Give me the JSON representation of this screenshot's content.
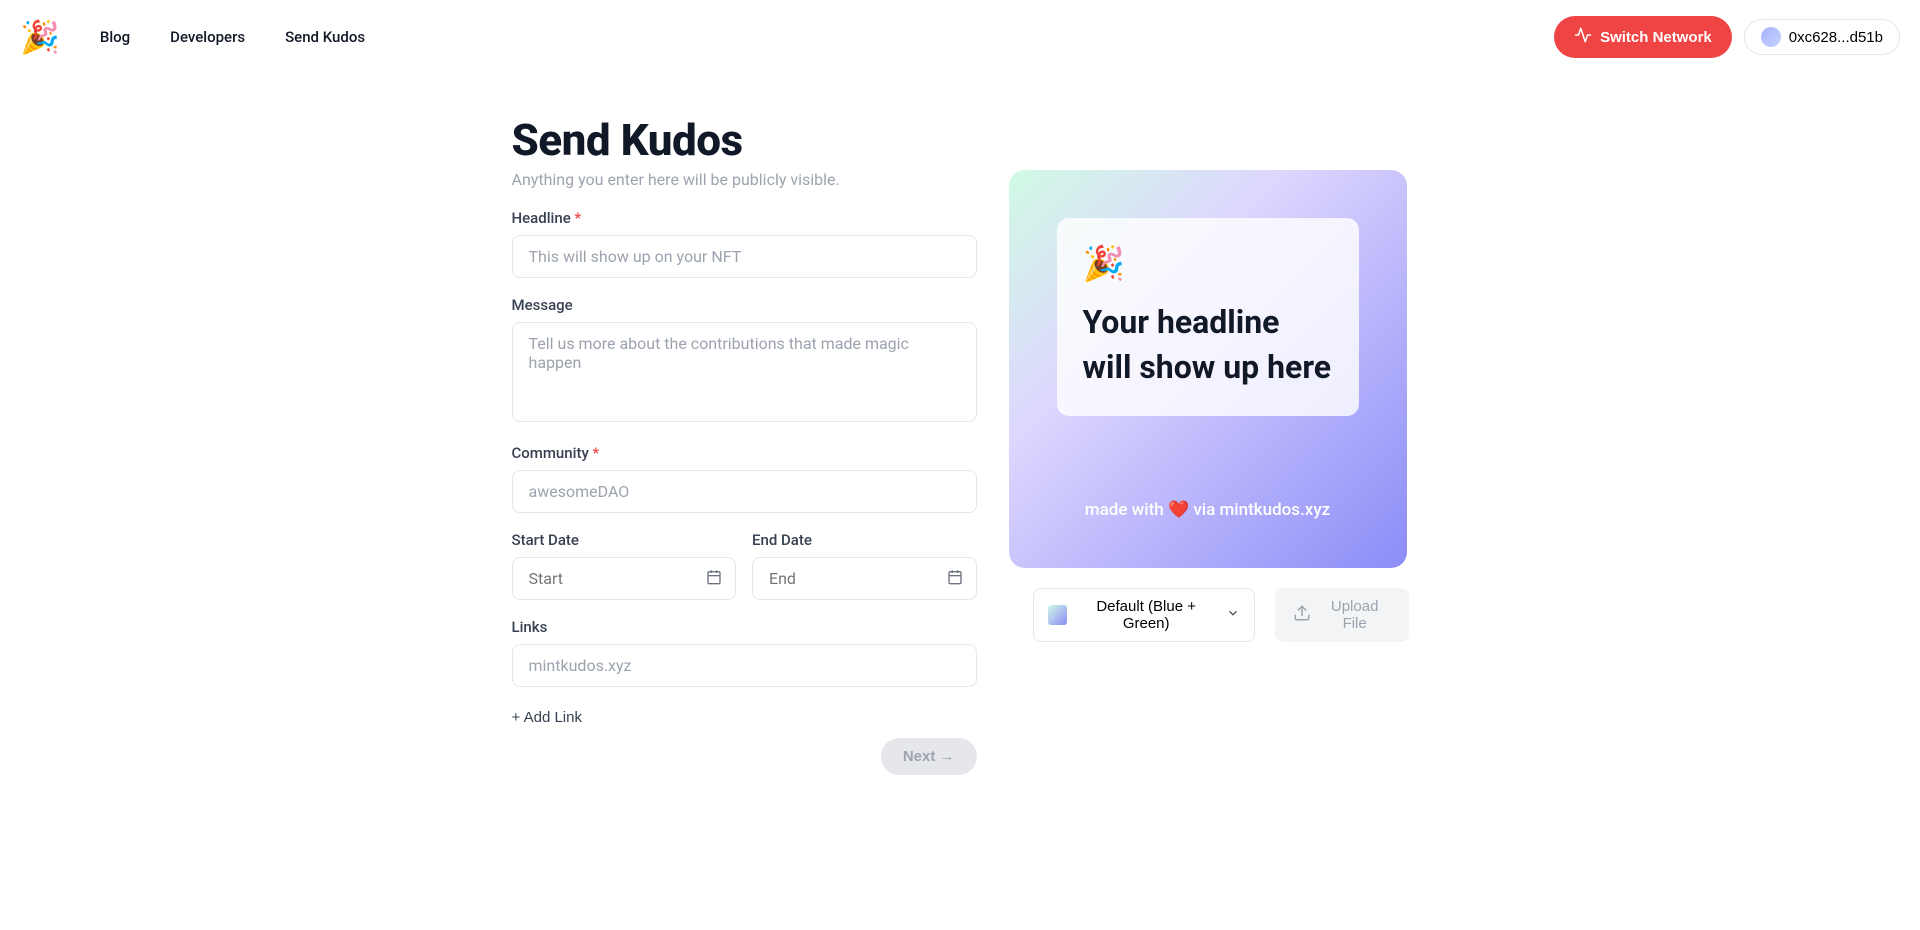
{
  "nav": {
    "links": [
      {
        "label": "Blog"
      },
      {
        "label": "Developers"
      },
      {
        "label": "Send Kudos"
      }
    ]
  },
  "header": {
    "switch_network_label": "Switch Network",
    "wallet_address": "0xc628...d51b"
  },
  "page": {
    "title": "Send Kudos",
    "subtitle": "Anything you enter here will be publicly visible."
  },
  "form": {
    "headline": {
      "label": "Headline",
      "placeholder": "This will show up on your NFT",
      "value": ""
    },
    "message": {
      "label": "Message",
      "placeholder": "Tell us more about the contributions that made magic happen",
      "value": ""
    },
    "community": {
      "label": "Community",
      "placeholder": "awesomeDAO",
      "value": ""
    },
    "start_date": {
      "label": "Start Date",
      "placeholder": "Start",
      "value": ""
    },
    "end_date": {
      "label": "End Date",
      "placeholder": "End",
      "value": ""
    },
    "links": {
      "label": "Links",
      "placeholder": "mintkudos.xyz",
      "value": ""
    },
    "add_link_label": "+ Add Link",
    "next_label": "Next →"
  },
  "preview": {
    "emoji": "🎉",
    "headline_placeholder": "Your headline will show up here",
    "footer_text": "made with ❤️ via mintkudos.xyz"
  },
  "controls": {
    "theme_label": "Default (Blue + Green)",
    "upload_label": "Upload File"
  }
}
